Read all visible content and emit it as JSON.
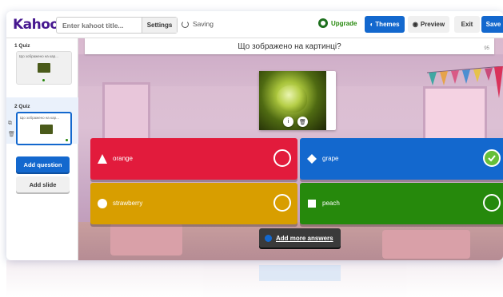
{
  "topbar": {
    "logo": "Kahoot!",
    "title_placeholder": "Enter kahoot title...",
    "settings_label": "Settings",
    "saving_label": "Saving",
    "upgrade_label": "Upgrade",
    "themes_label": "Themes",
    "preview_label": "Preview",
    "exit_label": "Exit",
    "save_label": "Save"
  },
  "sidebar": {
    "slides": [
      {
        "label": "1  Quiz",
        "question": "Що зображено на кар..."
      },
      {
        "label": "2  Quiz",
        "question": "Що зображено на кар..."
      }
    ],
    "add_question_label": "Add question",
    "add_slide_label": "Add slide"
  },
  "question": {
    "text": "Що зображено на картинці?",
    "char_count": "95"
  },
  "answers": [
    {
      "text": "orange",
      "shape": "triangle",
      "color": "#e21b3c",
      "correct": false
    },
    {
      "text": "grape",
      "shape": "diamond",
      "color": "#1368ce",
      "correct": true
    },
    {
      "text": "strawberry",
      "shape": "circle",
      "color": "#d89e00",
      "correct": false
    },
    {
      "text": "peach",
      "shape": "square",
      "color": "#26890c",
      "correct": false
    }
  ],
  "add_more_label": "Add more answers",
  "colors": {
    "brand": "#46178f",
    "accent": "#1368ce",
    "upgrade": "#26890c"
  },
  "icons": {
    "saving": "spinner-icon",
    "upgrade": "star-badge-icon",
    "themes": "palette-icon",
    "preview": "eye-icon",
    "media_info": "info-icon",
    "media_delete": "trash-icon",
    "duplicate": "duplicate-icon",
    "delete": "trash-icon",
    "add_more": "plus-icon"
  }
}
